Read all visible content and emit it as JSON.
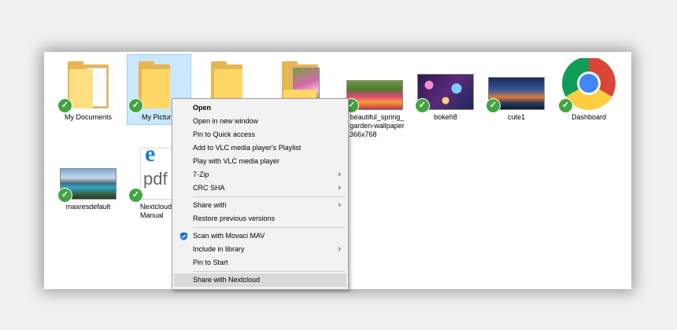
{
  "items": [
    {
      "label": "My Documents"
    },
    {
      "label": "My Pictur"
    },
    {
      "label": ""
    },
    {
      "label": ""
    },
    {
      "label_lines": [
        "beautiful_spring_",
        "garden-wallpaper",
        "-1366x768"
      ]
    },
    {
      "label": "bokeh8"
    },
    {
      "label": "cute1"
    },
    {
      "label": "Dashboard"
    },
    {
      "label": "maxresdefault"
    },
    {
      "label_lines": [
        "Nextcloud",
        "Manual"
      ],
      "pdf_text": "pdf"
    }
  ],
  "context_menu": {
    "items": [
      {
        "label": "Open"
      },
      {
        "label": "Open in new window"
      },
      {
        "label": "Pin to Quick access"
      },
      {
        "label": "Add to VLC media player's Playlist"
      },
      {
        "label": "Play with VLC media player"
      },
      {
        "label": "7-Zip"
      },
      {
        "label": "CRC SHA"
      },
      {
        "label": "Share with"
      },
      {
        "label": "Restore previous versions"
      },
      {
        "label": "Scan with Movaci MAV"
      },
      {
        "label": "Include in library"
      },
      {
        "label": "Pin to Start"
      },
      {
        "label": "Share with Nextcloud"
      }
    ]
  },
  "icons": {
    "sync_status": "green-check-icon",
    "submenu": "chevron-right-icon",
    "scan": "shield-icon",
    "browser": "chrome-icon",
    "edge": "edge-icon"
  },
  "colors": {
    "selection": "#cce8ff",
    "sync_check": "#44a441",
    "menu_highlight": "#d9d9d9"
  }
}
